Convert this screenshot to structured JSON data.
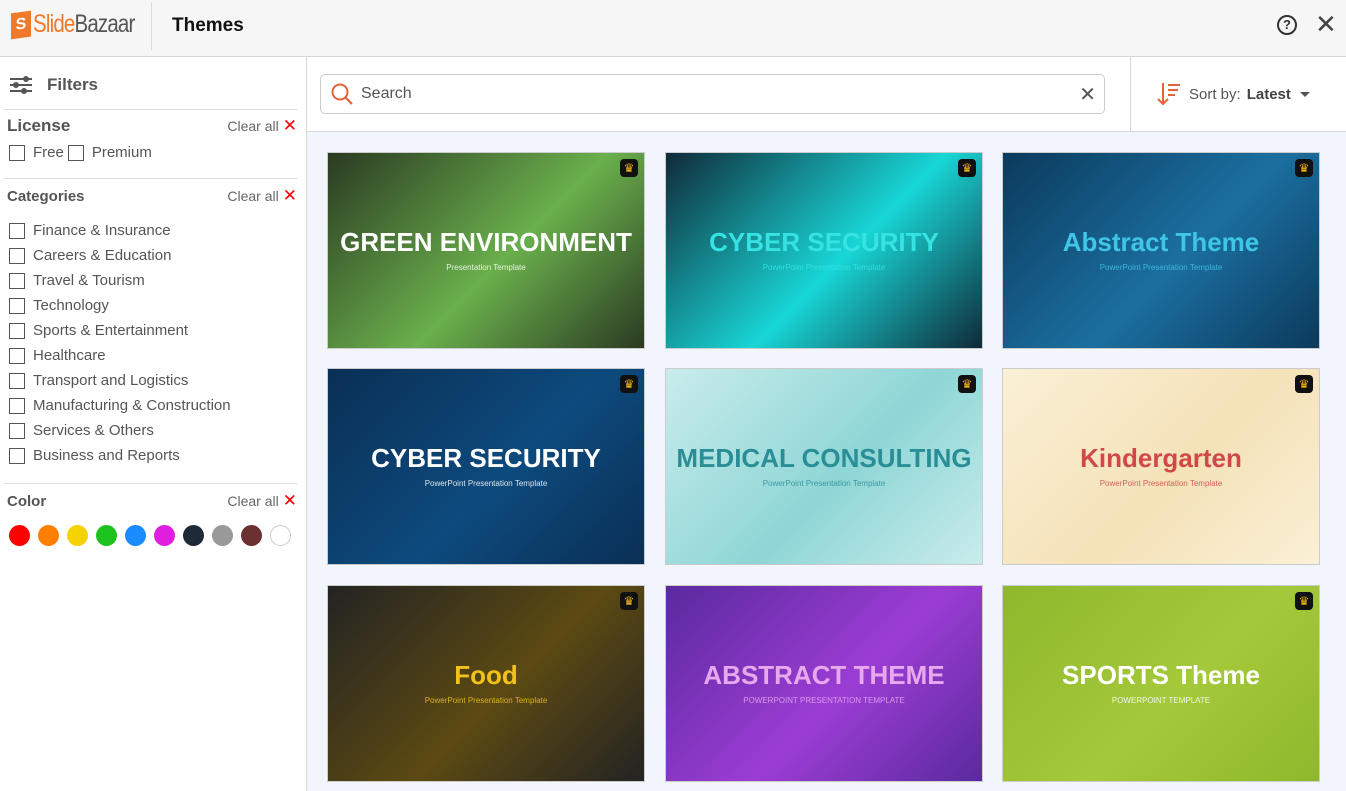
{
  "header": {
    "logo": "SlideBazaar",
    "logo_a": "Slide",
    "logo_b": "Bazaar",
    "title": "Themes",
    "help_icon": "?",
    "close_icon": "✕"
  },
  "sidebar": {
    "filters_label": "Filters",
    "license": {
      "title": "License",
      "clear": "Clear all",
      "options": [
        "Free",
        "Premium"
      ]
    },
    "categories": {
      "title": "Categories",
      "clear": "Clear all",
      "options": [
        "Finance & Insurance",
        "Careers & Education",
        "Travel & Tourism",
        "Technology",
        "Sports & Entertainment",
        "Healthcare",
        "Transport and Logistics",
        "Manufacturing & Construction",
        "Services & Others",
        "Business and Reports"
      ]
    },
    "color": {
      "title": "Color",
      "clear": "Clear all",
      "swatches": [
        "#ff0000",
        "#ff7f00",
        "#f5d300",
        "#1cc31c",
        "#1a8cff",
        "#e01ee0",
        "#1e2a36",
        "#999999",
        "#6b3030",
        "#ffffff"
      ]
    }
  },
  "search": {
    "placeholder": "Search",
    "value": ""
  },
  "sort": {
    "label": "Sort by:",
    "value": "Latest"
  },
  "themes": [
    {
      "title": "GREEN ENVIRONMENT",
      "subtitle": "Presentation Template",
      "bg": "#2a3a22",
      "accent": "#6ab04c",
      "fg": "#ffffff",
      "premium": true
    },
    {
      "title": "CYBER SECURITY",
      "subtitle": "PowerPoint Presentation Template",
      "bg": "#0f2a38",
      "accent": "#18d6d6",
      "fg": "#35e3e3",
      "premium": true
    },
    {
      "title": "Abstract Theme",
      "subtitle": "PowerPoint Presentation Template",
      "bg": "#0b3a5c",
      "accent": "#1b6fa0",
      "fg": "#3fc6e6",
      "premium": true
    },
    {
      "title": "CYBER SECURITY",
      "subtitle": "PowerPoint Presentation Template",
      "bg": "#0a2f55",
      "accent": "#0d4a7d",
      "fg": "#ffffff",
      "premium": true
    },
    {
      "title": "MEDICAL CONSULTING",
      "subtitle": "PowerPoint Presentation Template",
      "bg": "#c9ecec",
      "accent": "#8fd6d6",
      "fg": "#2a8e96",
      "premium": true
    },
    {
      "title": "Kindergarten",
      "subtitle": "PowerPoint Presentation Template",
      "bg": "#fbf0d6",
      "accent": "#f4e2b8",
      "fg": "#d04848",
      "premium": true
    },
    {
      "title": "Food",
      "subtitle": "PowerPoint Presentation Template",
      "bg": "#232323",
      "accent": "#5c4a12",
      "fg": "#f2c21a",
      "premium": true
    },
    {
      "title": "ABSTRACT THEME",
      "subtitle": "POWERPOINT PRESENTATION TEMPLATE",
      "bg": "#5a2a9e",
      "accent": "#9b3dd4",
      "fg": "#e7a8ee",
      "premium": false
    },
    {
      "title": "SPORTS Theme",
      "subtitle": "POWERPOINT TEMPLATE",
      "bg": "#8fb82c",
      "accent": "#a4c93a",
      "fg": "#ffffff",
      "premium": true
    }
  ]
}
